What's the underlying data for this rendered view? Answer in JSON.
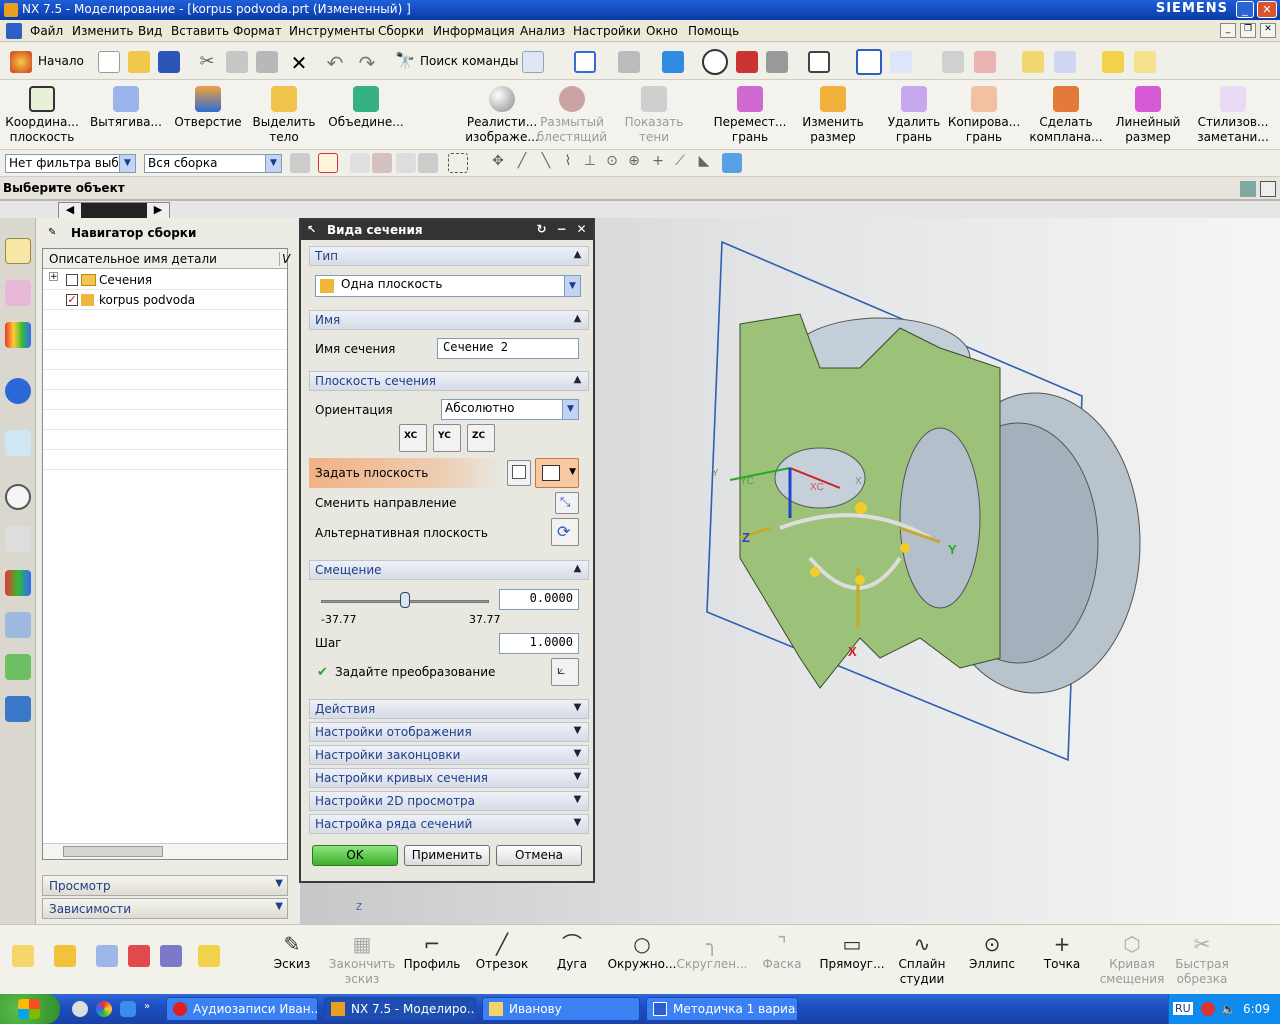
{
  "window": {
    "title": "NX 7.5 - Моделирование - [korpus podvoda.prt (Измененный) ]",
    "brand": "SIEMENS"
  },
  "menubar": [
    "Файл",
    "Изменить",
    "Вид",
    "Вставить",
    "Формат",
    "Инструменты",
    "Сборки",
    "Информация",
    "Анализ",
    "Настройки",
    "Окно",
    "Помощь"
  ],
  "toolbar1": {
    "start": "Начало",
    "command_search": "Поиск команды"
  },
  "toolbar2": [
    {
      "label": "Координа... плоскость",
      "disabled": false
    },
    {
      "label": "Вытягива...",
      "disabled": false
    },
    {
      "label": "Отверстие",
      "disabled": false
    },
    {
      "label": "Выделить тело",
      "disabled": false
    },
    {
      "label": "Объедине...",
      "disabled": false
    },
    {
      "label": "Реалисти... изображе...",
      "disabled": false
    },
    {
      "label": "Размытый блестящий",
      "disabled": true
    },
    {
      "label": "Показать тени",
      "disabled": true
    },
    {
      "label": "Перемест... грань",
      "disabled": false
    },
    {
      "label": "Изменить размер",
      "disabled": false
    },
    {
      "label": "Удалить грань",
      "disabled": false
    },
    {
      "label": "Копирова... грань",
      "disabled": false
    },
    {
      "label": "Сделать компланa...",
      "disabled": false
    },
    {
      "label": "Линейный размер",
      "disabled": false
    },
    {
      "label": "Стилизов... заметани...",
      "disabled": false
    }
  ],
  "filters": {
    "type_filter": "Нет фильтра выбор",
    "scope_filter": "Вся сборка"
  },
  "status": {
    "prompt": "Выберите объект"
  },
  "navigator": {
    "title": "Навигатор сборки",
    "column": "Описательное имя детали",
    "column2": "V",
    "rows": [
      {
        "label": "Сечения",
        "checked": false,
        "expander": "+"
      },
      {
        "label": "korpus podvoda",
        "checked": true,
        "expander": ""
      }
    ],
    "bottom_panels": [
      "Просмотр",
      "Зависимости"
    ]
  },
  "dialog": {
    "title": "Вида сечения",
    "sections": {
      "type": "Тип",
      "name": "Имя",
      "plane": "Плоскость сечения",
      "offset": "Смещение",
      "actions": "Действия",
      "display": "Настройки отображения",
      "cap": "Настройки законцовки",
      "curves": "Настройки кривых сечения",
      "preview2d": "Настройки 2D просмотра",
      "series": "Настройка ряда сечений"
    },
    "type_value": "Одна плоскость",
    "name_label": "Имя сечения",
    "name_value": "Сечение 2",
    "orientation_label": "Ориентация",
    "orientation_value": "Абсолютно",
    "axis_buttons": [
      "XC",
      "YC",
      "ZC"
    ],
    "specify_plane": "Задать плоскость",
    "reverse_direction": "Сменить направление",
    "alternate_plane": "Альтернативная плоскость",
    "slider_min": "-37.77",
    "slider_max": "37.77",
    "offset_value": "0.0000",
    "offset_fraction": 0.5,
    "step_label": "Шаг",
    "step_value": "1.0000",
    "transform_label": "Задайте преобразование",
    "buttons": {
      "ok": "OK",
      "apply": "Применить",
      "cancel": "Отмена"
    }
  },
  "viewport": {
    "triad": {
      "x": "X",
      "y": "Y",
      "z": "Z",
      "xc": "XC",
      "yc": "YC"
    },
    "model_color": "#9cc27a"
  },
  "bottom_toolbar": [
    {
      "label": "Эскиз",
      "glyph": "✎",
      "disabled": false
    },
    {
      "label": "Закончить эскиз",
      "glyph": "▦",
      "disabled": true
    },
    {
      "label": "Профиль",
      "glyph": "⌐",
      "disabled": false
    },
    {
      "label": "Отрезок",
      "glyph": "╱",
      "disabled": false
    },
    {
      "label": "Дуга",
      "glyph": "⌒",
      "disabled": false
    },
    {
      "label": "Окружно...",
      "glyph": "○",
      "disabled": false
    },
    {
      "label": "Скруглен...",
      "glyph": "╮",
      "disabled": true
    },
    {
      "label": "Фаска",
      "glyph": "⌝",
      "disabled": true
    },
    {
      "label": "Прямоуг...",
      "glyph": "▭",
      "disabled": false
    },
    {
      "label": "Сплайн студии",
      "glyph": "∿",
      "disabled": false
    },
    {
      "label": "Эллипс",
      "glyph": "⊙",
      "disabled": false
    },
    {
      "label": "Точка",
      "glyph": "+",
      "disabled": false
    },
    {
      "label": "Кривая смещения",
      "glyph": "⬡",
      "disabled": true
    },
    {
      "label": "Быстрая обрезка",
      "glyph": "✂",
      "disabled": true
    }
  ],
  "taskbar": {
    "tasks": [
      "Аудиозаписи Иван...",
      "NX 7.5 - Моделиро...",
      "Иванову",
      "Методичка 1 вариа..."
    ],
    "lang": "RU",
    "clock": "6:09"
  }
}
